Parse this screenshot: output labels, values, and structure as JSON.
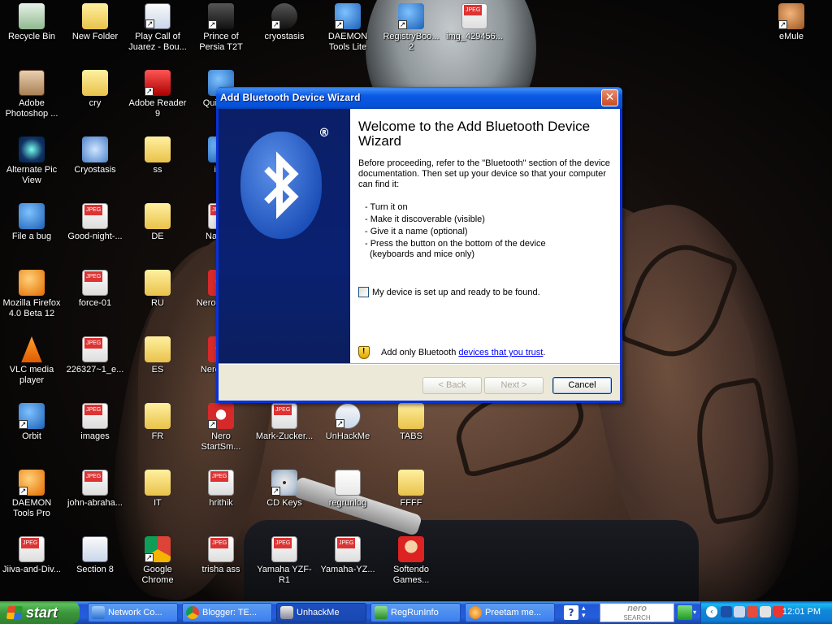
{
  "desktop": {
    "icons": [
      {
        "label": "Recycle Bin",
        "icon": "recycle-bin-icon"
      },
      {
        "label": "New Folder",
        "icon": "folder-icon"
      },
      {
        "label": "Play Call of Juarez - Bou...",
        "icon": "game-shortcut-icon"
      },
      {
        "label": "Prince of Persia T2T",
        "icon": "game-icon"
      },
      {
        "label": "cryostasis",
        "icon": "cryostasis-icon"
      },
      {
        "label": "DAEMON Tools Lite",
        "icon": "daemon-tools-icon"
      },
      {
        "label": "RegistryBoo... 2",
        "icon": "registry-booster-icon"
      },
      {
        "label": "img_429456...",
        "icon": "jpeg-icon"
      },
      {
        "label": "eMule",
        "icon": "emule-icon"
      },
      {
        "label": "Adobe Photoshop ...",
        "icon": "photoshop-icon"
      },
      {
        "label": "cry",
        "icon": "folder-icon"
      },
      {
        "label": "Adobe Reader 9",
        "icon": "adobe-reader-icon"
      },
      {
        "label": "Qui... P...",
        "icon": "quicktime-icon"
      },
      {
        "label": "Alternate Pic View",
        "icon": "eye-icon"
      },
      {
        "label": "Cryostasis",
        "icon": "cryostasis-icon"
      },
      {
        "label": "ss",
        "icon": "folder-icon"
      },
      {
        "label": "iT...",
        "icon": "itunes-icon"
      },
      {
        "label": "File a bug",
        "icon": "help-icon"
      },
      {
        "label": "Good-night-...",
        "icon": "jpeg-icon"
      },
      {
        "label": "DE",
        "icon": "folder-icon"
      },
      {
        "label": "Namit...",
        "icon": "jpeg-icon"
      },
      {
        "label": "Mozilla Firefox 4.0 Beta 12",
        "icon": "firefox-icon"
      },
      {
        "label": "force-01",
        "icon": "jpeg-icon"
      },
      {
        "label": "RU",
        "icon": "folder-icon"
      },
      {
        "label": "Nero Esse...",
        "icon": "nero-icon"
      },
      {
        "label": "VLC media player",
        "icon": "vlc-icon"
      },
      {
        "label": "226327~1_e...",
        "icon": "jpeg-icon"
      },
      {
        "label": "ES",
        "icon": "folder-icon"
      },
      {
        "label": "Nero Up...",
        "icon": "nero-icon"
      },
      {
        "label": "Orbit",
        "icon": "orbit-icon"
      },
      {
        "label": "images",
        "icon": "jpeg-icon"
      },
      {
        "label": "FR",
        "icon": "folder-icon"
      },
      {
        "label": "Nero StartSm...",
        "icon": "nero-icon"
      },
      {
        "label": "Mark-Zucker...",
        "icon": "jpeg-icon"
      },
      {
        "label": "UnHackMe",
        "icon": "unhackme-icon"
      },
      {
        "label": "TABS",
        "icon": "folder-icon"
      },
      {
        "label": "DAEMON Tools Pro",
        "icon": "daemon-tools-icon"
      },
      {
        "label": "john-abraha...",
        "icon": "jpeg-icon"
      },
      {
        "label": "IT",
        "icon": "folder-icon"
      },
      {
        "label": "hrithik",
        "icon": "jpeg-icon"
      },
      {
        "label": "CD Keys",
        "icon": "cd-icon"
      },
      {
        "label": "regrunlog",
        "icon": "text-file-icon"
      },
      {
        "label": "FFFF",
        "icon": "folder-icon"
      },
      {
        "label": "Jiiva-and-Div...",
        "icon": "jpeg-icon"
      },
      {
        "label": "Section 8",
        "icon": "game-shortcut-icon"
      },
      {
        "label": "Google Chrome",
        "icon": "chrome-icon"
      },
      {
        "label": "trisha ass",
        "icon": "jpeg-icon"
      },
      {
        "label": "Yamaha YZF-R1",
        "icon": "jpeg-icon"
      },
      {
        "label": "Yamaha-YZ...",
        "icon": "jpeg-icon"
      },
      {
        "label": "Softendo Games...",
        "icon": "mario-icon"
      }
    ]
  },
  "wizard": {
    "title": "Add Bluetooth Device Wizard",
    "close_glyph": "✕",
    "registered_mark": "®",
    "heading": "Welcome to the Add Bluetooth Device Wizard",
    "intro": "Before proceeding, refer to the \"Bluetooth\" section of the device documentation. Then set up your device so that your computer can find it:",
    "steps": [
      "- Turn it on",
      "- Make it discoverable (visible)",
      "- Give it a name (optional)",
      "- Press the button on the bottom of the device",
      "(keyboards and mice only)"
    ],
    "checkbox_label": "My device is set up and ready to be found.",
    "checkbox_checked": false,
    "trust_text": "Add only Bluetooth",
    "trust_link": "devices that you trust",
    "trust_suffix": ".",
    "buttons": {
      "back": "< Back",
      "next": "Next >",
      "cancel": "Cancel"
    }
  },
  "taskbar": {
    "start_label": "start",
    "tasks": [
      {
        "label": "Network Co...",
        "icon": "network-icon",
        "active": false
      },
      {
        "label": "Blogger: TE...",
        "icon": "chrome-icon",
        "active": false
      },
      {
        "label": "UnhackMe",
        "icon": "unhackme-icon",
        "active": true
      },
      {
        "label": "RegRunInfo",
        "icon": "regrun-icon",
        "active": false
      },
      {
        "label": "Preetam me...",
        "icon": "firefox-icon",
        "active": false
      }
    ],
    "nero_search_label": "nero",
    "nero_search_sub": "SEARCH",
    "clock": "12:01 PM"
  },
  "colors": {
    "taskbar_blue": "#245edb",
    "start_green": "#3b973b",
    "title_blue": "#0a58e4",
    "banner_navy": "#0a2172"
  }
}
